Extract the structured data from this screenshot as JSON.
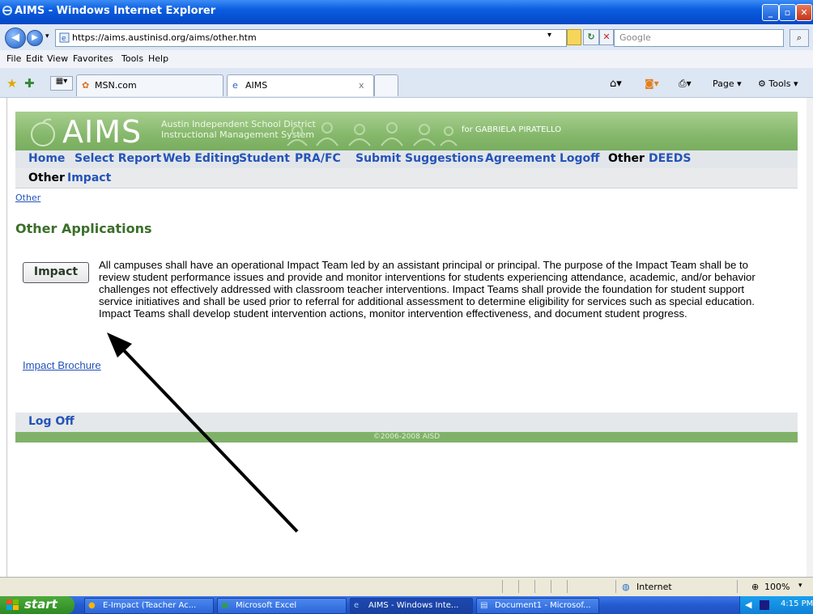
{
  "window": {
    "title": "AIMS - Windows Internet Explorer"
  },
  "address_bar": {
    "url": "https://aims.austinisd.org/aims/other.htm"
  },
  "search": {
    "placeholder": "Google"
  },
  "menu": [
    "File",
    "Edit",
    "View",
    "Favorites",
    "Tools",
    "Help"
  ],
  "tabs": [
    {
      "label": "MSN.com",
      "active": false
    },
    {
      "label": "AIMS",
      "active": true
    }
  ],
  "command_bar": {
    "page_label": "Page",
    "tools_label": "Tools"
  },
  "aims": {
    "logo": "AIMS",
    "district_line1": "Austin Independent School District",
    "district_line2": "Instructional Management System",
    "for_user": "for GABRIELA PIRATELLO",
    "nav": [
      "Home",
      "Select Report",
      "Web Editing",
      "Student",
      "PRA/FC",
      "Submit Suggestions",
      "Agreement",
      "Logoff",
      "Other",
      "DEEDS"
    ],
    "nav_current": "Other",
    "subnav": [
      "Other",
      "Impact"
    ],
    "breadcrumb": "Other",
    "page_title": "Other Applications",
    "impact_button": "Impact",
    "impact_description": "All campuses shall have an operational Impact Team led by an assistant principal or principal. The purpose of the Impact Team shall be to review student performance issues and provide and monitor interventions for students experiencing attendance, academic, and/or behavior challenges not effectively addressed with classroom teacher interventions. Impact Teams shall provide the foundation for student support service initiatives and shall be used prior to referral for additional assessment to determine eligibility for services such as special education. Impact Teams shall develop student intervention actions, monitor intervention effectiveness, and document student progress.",
    "brochure_link": "Impact Brochure",
    "logoff": "Log Off",
    "footer": "©2006-2008 AISD"
  },
  "status_bar": {
    "zone": "Internet",
    "zoom": "100%"
  },
  "taskbar": {
    "start": "start",
    "items": [
      "E-Impact (Teacher Ac...",
      "Microsoft Excel",
      "AIMS - Windows Inte...",
      "Document1 - Microsof..."
    ],
    "clock": "4:15 PM"
  },
  "colors": {
    "aims_green": "#86b86c",
    "link_blue": "#2453b8",
    "title_green": "#3b6f2a"
  }
}
